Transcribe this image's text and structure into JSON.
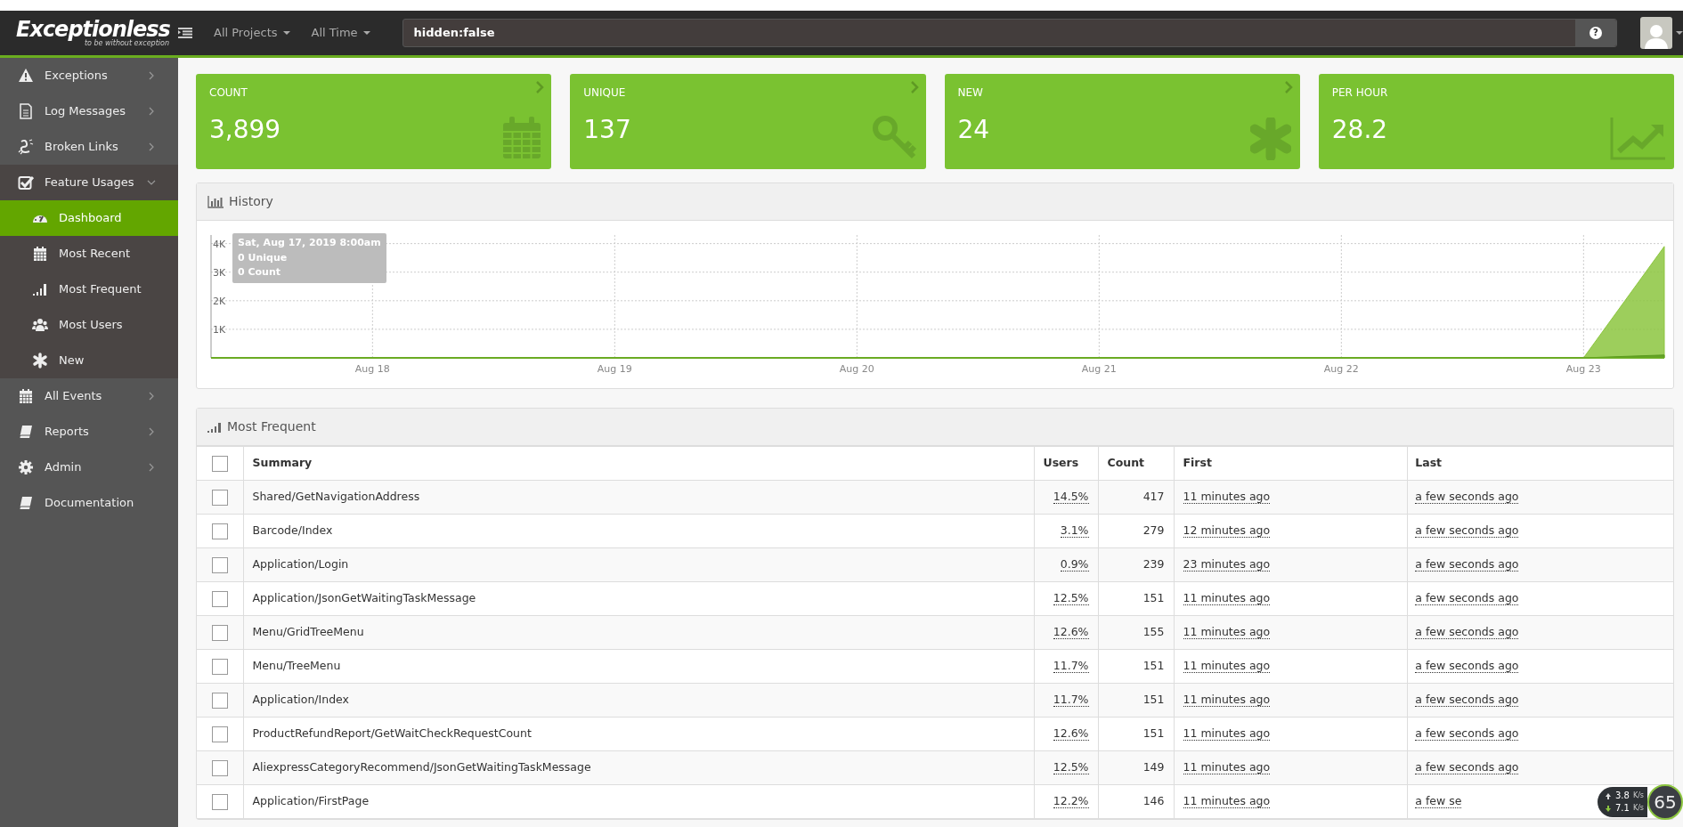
{
  "navbar": {
    "logo": "Exceptionless",
    "tagline": "to be without exception",
    "filters": [
      {
        "label": "All Projects"
      },
      {
        "label": "All Time"
      }
    ],
    "search": {
      "value": "hidden:false"
    },
    "help_button": "?"
  },
  "sidebar": {
    "items": [
      {
        "label": "Exceptions",
        "expanded": false
      },
      {
        "label": "Log Messages",
        "expanded": false
      },
      {
        "label": "Broken Links",
        "expanded": false
      },
      {
        "label": "Feature Usages",
        "expanded": true,
        "children": [
          {
            "label": "Dashboard",
            "selected": true
          },
          {
            "label": "Most Recent",
            "selected": false
          },
          {
            "label": "Most Frequent",
            "selected": false
          },
          {
            "label": "Most Users",
            "selected": false
          },
          {
            "label": "New",
            "selected": false
          }
        ]
      },
      {
        "label": "All Events",
        "expanded": false
      },
      {
        "label": "Reports",
        "expanded": false
      },
      {
        "label": "Admin",
        "expanded": false
      },
      {
        "label": "Documentation"
      }
    ]
  },
  "stats": [
    {
      "title": "COUNT",
      "value": "3,899",
      "link": true
    },
    {
      "title": "UNIQUE",
      "value": "137",
      "link": true
    },
    {
      "title": "NEW",
      "value": "24",
      "link": true
    },
    {
      "title": "PER HOUR",
      "value": "28.2",
      "link": false
    }
  ],
  "history": {
    "title": "History",
    "tooltip": {
      "date": "Sat, Aug 17, 2019 8:00am",
      "values": [
        "0",
        "0"
      ]
    },
    "chart_data": {
      "type": "area",
      "grid": true,
      "categories": [
        null,
        null,
        "Aug 18",
        null,
        null,
        "Aug 19",
        null,
        null,
        "Aug 20",
        null,
        null,
        "Aug 21",
        null,
        null,
        "Aug 22",
        null,
        null,
        "Aug 23",
        null
      ],
      "ylim": [
        0,
        4300
      ],
      "yticks": [
        {
          "value": 1000,
          "label": "1K"
        },
        {
          "value": 2000,
          "label": "2K"
        },
        {
          "value": 3000,
          "label": "3K"
        },
        {
          "value": 4000,
          "label": "4K"
        }
      ],
      "series": [
        {
          "name": "Unique",
          "color": "#5a9a1e",
          "values": [
            0,
            0,
            0,
            0,
            0,
            0,
            0,
            0,
            0,
            0,
            0,
            0,
            0,
            0,
            0,
            0,
            0,
            0,
            100
          ]
        },
        {
          "name": "Count",
          "color": "#8cc63f",
          "values": [
            0,
            0,
            0,
            0,
            0,
            0,
            0,
            0,
            0,
            0,
            0,
            0,
            0,
            0,
            0,
            0,
            0,
            0,
            3900
          ]
        }
      ]
    }
  },
  "table": {
    "title": "Most Frequent",
    "select_all_checked": false,
    "columns": [
      "Summary",
      "Users",
      "Count",
      "First",
      "Last"
    ],
    "rows": [
      {
        "summary": "Shared/GetNavigationAddress",
        "users": "14.5%",
        "count": "417",
        "first": "11 minutes ago",
        "last": "a few seconds ago",
        "checked": false
      },
      {
        "summary": "Barcode/Index",
        "users": "3.1%",
        "count": "279",
        "first": "12 minutes ago",
        "last": "a few seconds ago",
        "checked": false
      },
      {
        "summary": "Application/Login",
        "users": "0.9%",
        "count": "239",
        "first": "23 minutes ago",
        "last": "a few seconds ago",
        "checked": false
      },
      {
        "summary": "Application/JsonGetWaitingTaskMessage",
        "users": "12.5%",
        "count": "151",
        "first": "11 minutes ago",
        "last": "a few seconds ago",
        "checked": false
      },
      {
        "summary": "Menu/GridTreeMenu",
        "users": "12.6%",
        "count": "155",
        "first": "11 minutes ago",
        "last": "a few seconds ago",
        "checked": false
      },
      {
        "summary": "Menu/TreeMenu",
        "users": "11.7%",
        "count": "151",
        "first": "11 minutes ago",
        "last": "a few seconds ago",
        "checked": false
      },
      {
        "summary": "Application/Index",
        "users": "11.7%",
        "count": "151",
        "first": "11 minutes ago",
        "last": "a few seconds ago",
        "checked": false
      },
      {
        "summary": "ProductRefundReport/GetWaitCheckRequestCount",
        "users": "12.6%",
        "count": "151",
        "first": "11 minutes ago",
        "last": "a few seconds ago",
        "checked": false
      },
      {
        "summary": "AliexpressCategoryRecommend/JsonGetWaitingTaskMessage",
        "users": "12.5%",
        "count": "149",
        "first": "11 minutes ago",
        "last": "a few seconds ago",
        "checked": false
      },
      {
        "summary": "Application/FirstPage",
        "users": "12.2%",
        "count": "146",
        "first": "11 minutes ago",
        "last": "a few se",
        "checked": false
      }
    ]
  },
  "speed_widget": {
    "upload": "3.8",
    "upload_unit": "K/s",
    "download": "7.1",
    "download_unit": "K/s",
    "gauge": "65"
  }
}
